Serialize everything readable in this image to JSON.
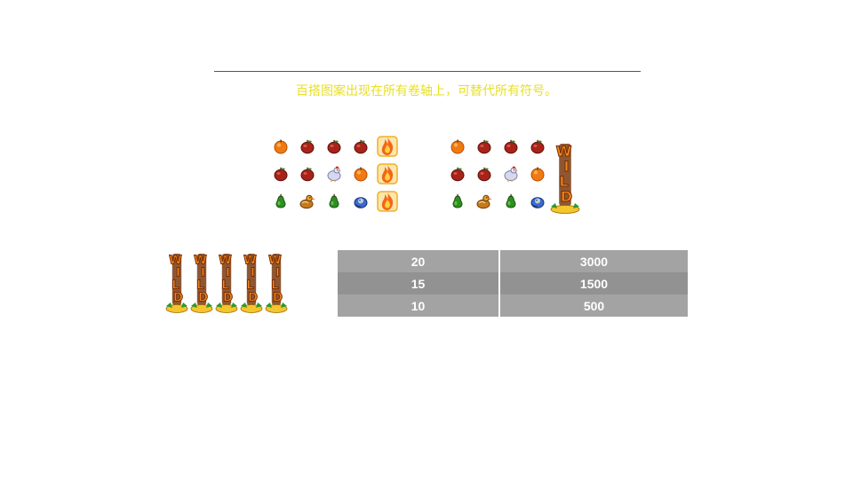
{
  "rule": {
    "text": "百搭图案出现在所有卷轴上，可替代所有符号。"
  },
  "symbols": {
    "orange": "orange-icon",
    "apple": "red-apple-icon",
    "pear": "green-pear-icon",
    "chicken": "chicken-icon",
    "duck": "duck-icon",
    "bird": "blue-bird-icon",
    "fire": "fire-wild-icon",
    "wild": "wild-totem-icon"
  },
  "example_left": [
    [
      "orange",
      "apple",
      "apple",
      "apple",
      "fire"
    ],
    [
      "apple",
      "apple",
      "chicken",
      "orange",
      "fire"
    ],
    [
      "pear",
      "duck",
      "pear",
      "bird",
      "fire"
    ]
  ],
  "example_right": [
    [
      "orange",
      "apple",
      "apple",
      "apple"
    ],
    [
      "apple",
      "apple",
      "chicken",
      "orange"
    ],
    [
      "pear",
      "duck",
      "pear",
      "bird"
    ]
  ],
  "wild_word": "WILD",
  "paytable": [
    {
      "count": "20",
      "payout": "3000"
    },
    {
      "count": "15",
      "payout": "1500"
    },
    {
      "count": "10",
      "payout": "500"
    }
  ],
  "colors": {
    "rule_text": "#e8e021",
    "table_light": "#a3a3a3",
    "table_dark": "#929292",
    "wild_orange": "#f08a1c",
    "wild_gold": "#f4c52c"
  }
}
